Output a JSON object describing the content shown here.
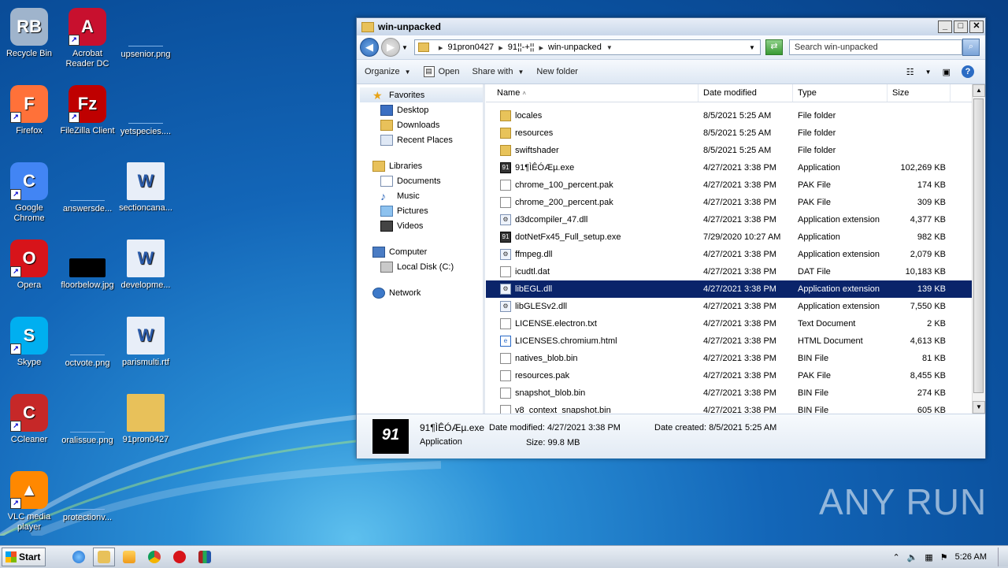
{
  "desktop": {
    "icons": [
      {
        "label": "Recycle Bin"
      },
      {
        "label": "Acrobat Reader DC"
      },
      {
        "label": "upsenior.png"
      },
      {
        "label": "Firefox"
      },
      {
        "label": "FileZilla Client"
      },
      {
        "label": "yetspecies...."
      },
      {
        "label": "Google Chrome"
      },
      {
        "label": "answersde..."
      },
      {
        "label": "sectioncana..."
      },
      {
        "label": "Opera"
      },
      {
        "label": "floorbelow.jpg"
      },
      {
        "label": "developme..."
      },
      {
        "label": "Skype"
      },
      {
        "label": "octvote.png"
      },
      {
        "label": "parismulti.rtf"
      },
      {
        "label": "CCleaner"
      },
      {
        "label": "oralissue.png"
      },
      {
        "label": "91pron0427"
      },
      {
        "label": "VLC media player"
      },
      {
        "label": "protectionv..."
      }
    ],
    "watermark": "ANY RUN"
  },
  "window": {
    "title": "win-unpacked",
    "breadcrumb": [
      "91pron0427",
      "91¦¦-+¦¦",
      "win-unpacked"
    ],
    "search_placeholder": "Search win-unpacked",
    "toolbar": {
      "organize": "Organize",
      "open": "Open",
      "share_with": "Share with",
      "new_folder": "New folder"
    },
    "nav": {
      "favorites": "Favorites",
      "desktop": "Desktop",
      "downloads": "Downloads",
      "recent_places": "Recent Places",
      "libraries": "Libraries",
      "documents": "Documents",
      "music": "Music",
      "pictures": "Pictures",
      "videos": "Videos",
      "computer": "Computer",
      "local_disk": "Local Disk (C:)",
      "network": "Network"
    },
    "columns": {
      "name": "Name",
      "date": "Date modified",
      "type": "Type",
      "size": "Size"
    },
    "files": [
      {
        "name": "locales",
        "date": "8/5/2021 5:25 AM",
        "type": "File folder",
        "size": "",
        "icon": "folder"
      },
      {
        "name": "resources",
        "date": "8/5/2021 5:25 AM",
        "type": "File folder",
        "size": "",
        "icon": "folder"
      },
      {
        "name": "swiftshader",
        "date": "8/5/2021 5:25 AM",
        "type": "File folder",
        "size": "",
        "icon": "folder"
      },
      {
        "name": "91¶ÌÊÓÆµ.exe",
        "date": "4/27/2021 3:38 PM",
        "type": "Application",
        "size": "102,269 KB",
        "icon": "app"
      },
      {
        "name": "chrome_100_percent.pak",
        "date": "4/27/2021 3:38 PM",
        "type": "PAK File",
        "size": "174 KB",
        "icon": "file"
      },
      {
        "name": "chrome_200_percent.pak",
        "date": "4/27/2021 3:38 PM",
        "type": "PAK File",
        "size": "309 KB",
        "icon": "file"
      },
      {
        "name": "d3dcompiler_47.dll",
        "date": "4/27/2021 3:38 PM",
        "type": "Application extension",
        "size": "4,377 KB",
        "icon": "dll"
      },
      {
        "name": "dotNetFx45_Full_setup.exe",
        "date": "7/29/2020 10:27 AM",
        "type": "Application",
        "size": "982 KB",
        "icon": "app"
      },
      {
        "name": "ffmpeg.dll",
        "date": "4/27/2021 3:38 PM",
        "type": "Application extension",
        "size": "2,079 KB",
        "icon": "dll"
      },
      {
        "name": "icudtl.dat",
        "date": "4/27/2021 3:38 PM",
        "type": "DAT File",
        "size": "10,183 KB",
        "icon": "file"
      },
      {
        "name": "libEGL.dll",
        "date": "4/27/2021 3:38 PM",
        "type": "Application extension",
        "size": "139 KB",
        "icon": "dll",
        "selected": true
      },
      {
        "name": "libGLESv2.dll",
        "date": "4/27/2021 3:38 PM",
        "type": "Application extension",
        "size": "7,550 KB",
        "icon": "dll"
      },
      {
        "name": "LICENSE.electron.txt",
        "date": "4/27/2021 3:38 PM",
        "type": "Text Document",
        "size": "2 KB",
        "icon": "file"
      },
      {
        "name": "LICENSES.chromium.html",
        "date": "4/27/2021 3:38 PM",
        "type": "HTML Document",
        "size": "4,613 KB",
        "icon": "html"
      },
      {
        "name": "natives_blob.bin",
        "date": "4/27/2021 3:38 PM",
        "type": "BIN File",
        "size": "81 KB",
        "icon": "file"
      },
      {
        "name": "resources.pak",
        "date": "4/27/2021 3:38 PM",
        "type": "PAK File",
        "size": "8,455 KB",
        "icon": "file"
      },
      {
        "name": "snapshot_blob.bin",
        "date": "4/27/2021 3:38 PM",
        "type": "BIN File",
        "size": "274 KB",
        "icon": "file"
      },
      {
        "name": "v8_context_snapshot.bin",
        "date": "4/27/2021 3:38 PM",
        "type": "BIN File",
        "size": "605 KB",
        "icon": "file"
      }
    ],
    "details": {
      "thumb_text": "91",
      "name": "91¶ÌÊÓÆµ.exe",
      "kind": "Application",
      "modified": "Date modified: 4/27/2021 3:38 PM",
      "created": "Date created: 8/5/2021 5:25 AM",
      "size": "Size: 99.8 MB"
    }
  },
  "taskbar": {
    "start": "Start",
    "clock": "5:26 AM"
  }
}
